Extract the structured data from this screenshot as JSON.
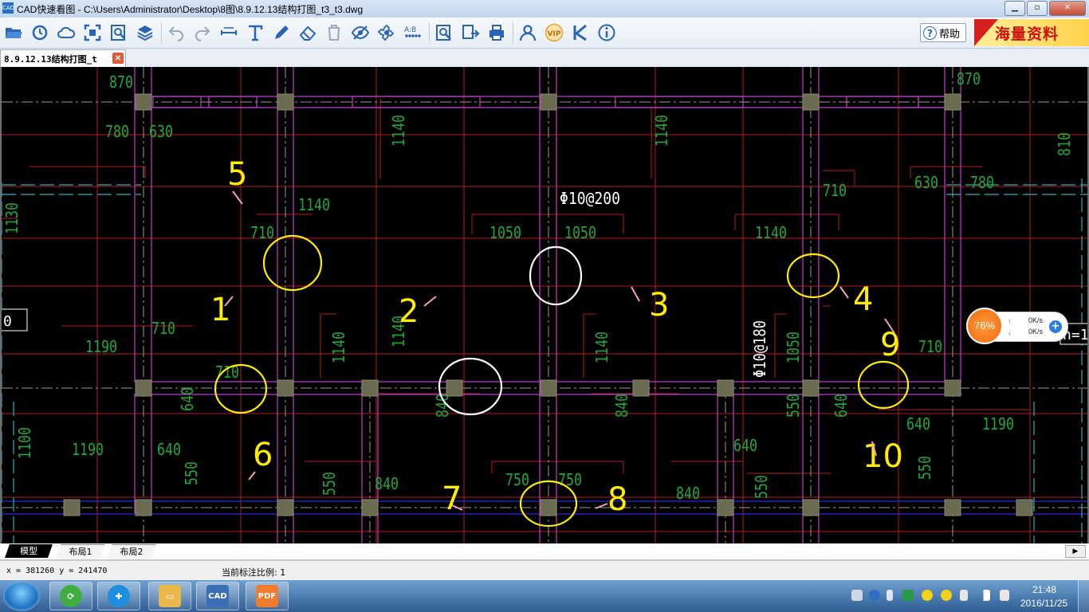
{
  "window": {
    "title": "CAD快速看图 - C:\\Users\\Administrator\\Desktop\\8图\\8.9.12.13结构打图_t3_t3.dwg",
    "app_icon_text": "CAD",
    "minimize_icon": "minimize-icon",
    "maximize_icon": "maximize-icon",
    "close_icon": "close-icon"
  },
  "toolbar": {
    "icons": [
      "open-folder-icon",
      "history-icon",
      "cloud-icon",
      "fit-screen-icon",
      "zoom-window-icon",
      "layers-icon",
      "undo-icon",
      "redo-icon",
      "measure-icon",
      "text-icon",
      "pen-icon",
      "eraser-icon",
      "delete-icon",
      "hide-icon",
      "settings-icon",
      "scale-icon",
      "find-text-icon",
      "export-icon",
      "print-icon",
      "user-icon",
      "vip-icon",
      "k-icon",
      "info-icon"
    ],
    "vip_label": "VIP",
    "help_label": "帮助",
    "help_icon_text": "?",
    "ad_text": "海量资料",
    "colors": {
      "icon_blue": "#2a64b4",
      "vip_orange": "#e9a23b",
      "ad_red": "#d01010"
    }
  },
  "doc_tab": {
    "label": "8.9.12.13结构打图_t",
    "close_glyph": "×"
  },
  "drawing": {
    "dimension_labels": [
      "870",
      "780",
      "630",
      "1140",
      "1140",
      "1140",
      "630",
      "780",
      "810",
      "870",
      "710",
      "1140",
      "1050",
      "1050",
      "1140",
      "710",
      "1130",
      "710",
      "1190",
      "1190",
      "710",
      "1140",
      "1140",
      "1050",
      "710",
      "640",
      "840",
      "840",
      "550",
      "640",
      "640",
      "1190",
      "640",
      "1190",
      "1100",
      "550",
      "840",
      "550",
      "750",
      "750",
      "840",
      "550",
      "550",
      "640"
    ],
    "rebar_labels": [
      "Φ10@200",
      "Φ10@180"
    ],
    "annotation_numbers": [
      "1",
      "2",
      "3",
      "4",
      "5",
      "6",
      "7",
      "8",
      "9",
      "10"
    ],
    "edge_labels": [
      "0",
      "h=1"
    ],
    "colors": {
      "background": "#000000",
      "beam_magenta": "#c040c0",
      "dim_green": "#22b03a",
      "rebar_red": "#c02020",
      "axis_blue": "#2e2ee0",
      "column_gray": "#6b6b50",
      "marker_yellow": "#ffee00",
      "marker_white": "#ffffff"
    }
  },
  "speed_widget": {
    "percent": "76%",
    "upload_icon": "upload-arrow-icon",
    "download_icon": "download-arrow-icon",
    "upload_speed": "0K/s",
    "download_speed": "0K/s",
    "plus_glyph": "+"
  },
  "layout_tabs": {
    "tabs": [
      "模型",
      "布局1",
      "布局2"
    ],
    "active": "模型"
  },
  "status": {
    "coords": "x = 381260  y = 241470",
    "scale": "当前标注比例: 1"
  },
  "taskbar": {
    "apps": [
      {
        "name": "sync-app-icon",
        "label": "",
        "color": "#3fae3f"
      },
      {
        "name": "plus-app-icon",
        "label": "",
        "color": "#1e8fe0"
      },
      {
        "name": "folder-app-icon",
        "label": "",
        "color": "#e8b84a"
      },
      {
        "name": "cad-app-icon",
        "label": "CAD",
        "color": "#3a6fb8"
      },
      {
        "name": "pdf-app-icon",
        "label": "PDF",
        "color": "#f07b2a"
      }
    ],
    "time": "21:48",
    "date": "2016/11/25"
  }
}
